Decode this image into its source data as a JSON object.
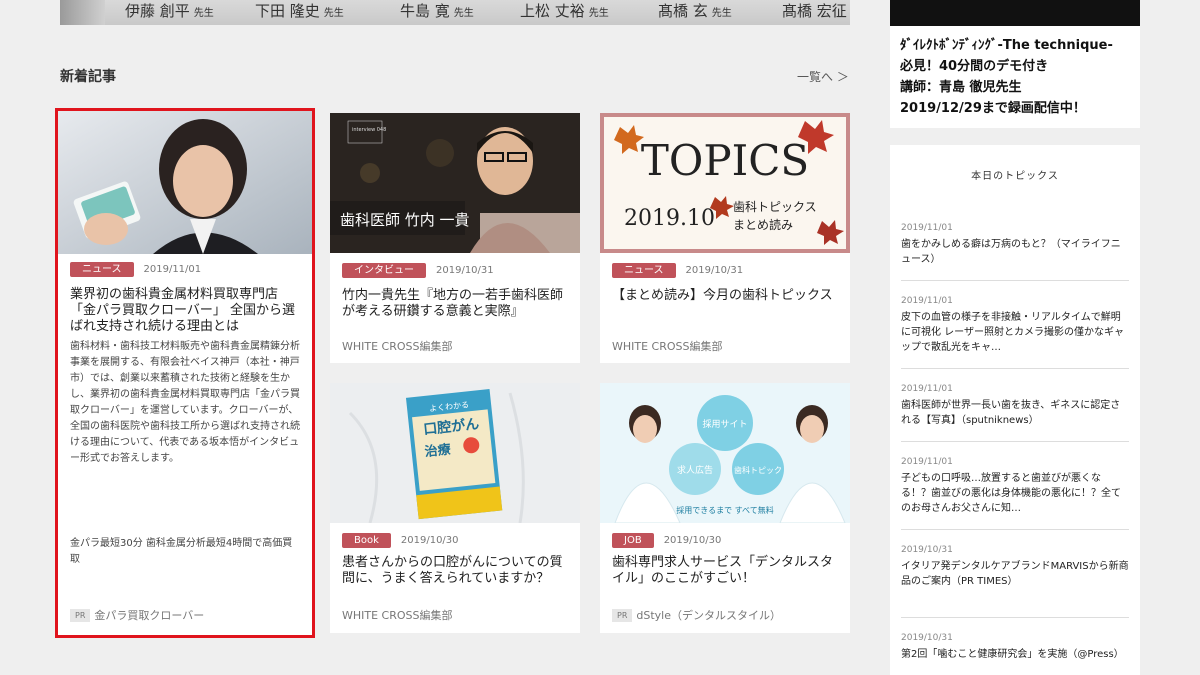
{
  "doctor_names": [
    {
      "name": "伊藤 創平",
      "suffix": "先生"
    },
    {
      "name": "下田 隆史",
      "suffix": "先生"
    },
    {
      "name": "牛島 寛",
      "suffix": "先生"
    },
    {
      "name": "上松 丈裕",
      "suffix": "先生"
    },
    {
      "name": "髙橋 玄",
      "suffix": "先生"
    },
    {
      "name": "髙橋 宏征",
      "suffix": ""
    }
  ],
  "section": {
    "title": "新着記事",
    "more": "一覧へ ＞"
  },
  "featured": {
    "tag": "ニュース",
    "date": "2019/11/01",
    "title": "業界初の歯科貴金属材料買取専門店「金パラ買取クローバー」 全国から選ばれ支持され続ける理由とは",
    "description": "歯科材料・歯科技工材料販売や歯科貴金属精錬分析事業を展開する、有限会社ベイス神戸（本社・神戸市）では、創業以来蓄積された技術と経験を生かし、業界初の歯科貴金属材料買取専門店「金パラ買取クローバー」を運営しています。クローバーが、全国の歯科医院や歯科技工所から選ばれ支持され続ける理由について、代表である坂本悟がインタビュー形式でお答えします。",
    "extra": "金パラ最短30分 歯科金属分析最短4時間で高価買取",
    "pr": "PR",
    "source": "金パラ買取クローバー"
  },
  "cards": [
    {
      "tag": "インタビュー",
      "date": "2019/10/31",
      "title": "竹内一貴先生『地方の一若手歯科医師が考える研鑽する意義と実際』",
      "source": "WHITE CROSS編集部",
      "thumb_caption": "歯科医師 竹内 一貴",
      "thumb_label": "interview 048"
    },
    {
      "tag": "ニュース",
      "date": "2019/10/31",
      "title": "【まとめ読み】今月の歯科トピックス",
      "source": "WHITE CROSS編集部",
      "thumb_big": "TOPICS",
      "thumb_date": "2019.10",
      "thumb_sub1": "歯科トピックス",
      "thumb_sub2": "まとめ読み"
    },
    {
      "tag": "Book",
      "date": "2019/10/30",
      "title": "患者さんからの口腔がんについての質問に、うまく答えられていますか？",
      "source": "WHITE CROSS編集部",
      "thumb_book1": "よくわかる",
      "thumb_book2": "口腔がん",
      "thumb_book3": "治療"
    },
    {
      "tag": "JOB",
      "date": "2019/10/30",
      "title": "歯科専門求人サービス「デンタルスタイル」のここがすごい！",
      "pr": "PR",
      "source": "dStyle（デンタルスタイル）",
      "thumb_c1": "採用サイト",
      "thumb_c2": "求人広告",
      "thumb_c3": "歯科トピック",
      "thumb_c4": "採用できるまで すべて無料"
    }
  ],
  "ad": {
    "line1": "ﾀﾞｲﾚｸﾄﾎﾞﾝﾃﾞｨﾝｸﾞ-The technique-",
    "line2": "必見！40分間のデモ付き",
    "line3": "講師：青島 徹児先生",
    "line4": "2019/12/29まで録画配信中！"
  },
  "topics": {
    "heading": "本日のトピックス",
    "items": [
      {
        "date": "2019/11/01",
        "title": "歯をかみしめる癖は万病のもと？（マイライフニュース）"
      },
      {
        "date": "2019/11/01",
        "title": "皮下の血管の様子を非接触・リアルタイムで鮮明に可視化 レーザー照射とカメラ撮影の僅かなギャップで散乱光をキャ…"
      },
      {
        "date": "2019/11/01",
        "title": "歯科医師が世界一長い歯を抜き、ギネスに認定される【写真】（sputniknews）"
      },
      {
        "date": "2019/11/01",
        "title": "子どもの口呼吸…放置すると歯並びが悪くなる！？歯並びの悪化は身体機能の悪化に！？全てのお母さんお父さんに知…"
      },
      {
        "date": "2019/10/31",
        "title": "イタリア発デンタルケアブランドMARVISから新商品のご案内（PR TIMES）"
      },
      {
        "date": "2019/10/31",
        "title": "第2回「噛むこと健康研究会」を実施（@Press）"
      }
    ]
  },
  "colors": {
    "tag": "#c0525a",
    "highlight": "#e0141d"
  }
}
